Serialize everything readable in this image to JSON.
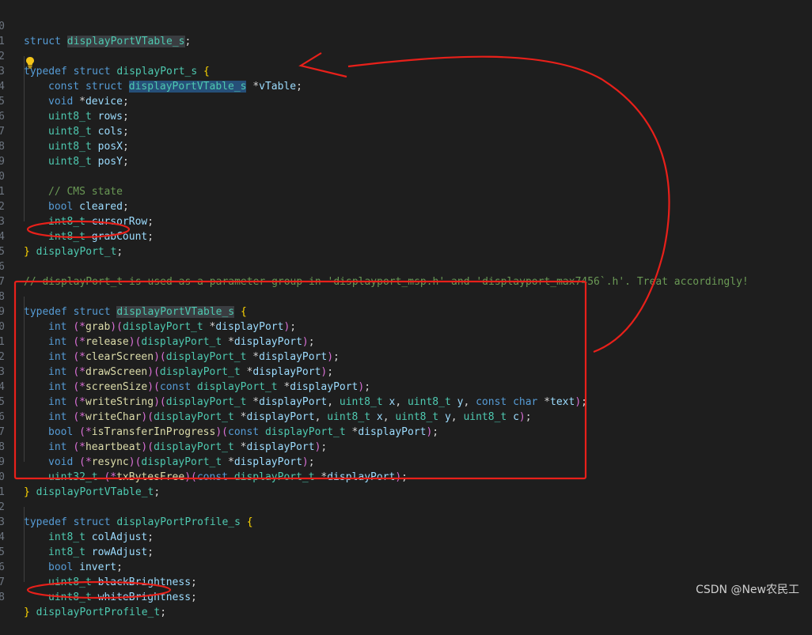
{
  "line_numbers": [
    "0",
    "1",
    "2",
    "3",
    "4",
    "5",
    "6",
    "7",
    "8",
    "9",
    "0",
    "1",
    "2",
    "3",
    "4",
    "5",
    "6",
    "7",
    "8",
    "9",
    "0",
    "1",
    "2",
    "3",
    "4",
    "5",
    "6",
    "7",
    "8",
    "9",
    "0",
    "1",
    "2",
    "3",
    "4",
    "5",
    "6",
    "7",
    "8",
    "9",
    "0"
  ],
  "code": {
    "l0": [
      "struct",
      "displayPortVTable_s",
      ";"
    ],
    "l2": [
      "typedef",
      "struct",
      "displayPort_s",
      "{"
    ],
    "l3": [
      "const",
      "struct",
      "displayPortVTable_s",
      "*",
      "vTable",
      ";"
    ],
    "l4": [
      "void",
      "*",
      "device",
      ";"
    ],
    "l5": [
      "uint8_t",
      "rows",
      ";"
    ],
    "l6": [
      "uint8_t",
      "cols",
      ";"
    ],
    "l7": [
      "uint8_t",
      "posX",
      ";"
    ],
    "l8": [
      "uint8_t",
      "posY",
      ";"
    ],
    "l10": [
      "// CMS state"
    ],
    "l11": [
      "bool",
      "cleared",
      ";"
    ],
    "l12": [
      "int8_t",
      "cursorRow",
      ";"
    ],
    "l13": [
      "int8_t",
      "grabCount",
      ";"
    ],
    "l14": [
      "}",
      "displayPort_t",
      ";"
    ],
    "l16": [
      "// displayPort_t is used as a parameter group in 'displayport_msp.h' and 'displayport_max7456`.h'. Treat accordingly!"
    ],
    "l18": [
      "typedef",
      "struct",
      "displayPortVTable_s",
      "{"
    ],
    "l19": [
      "int",
      "(*",
      "grab",
      ")",
      "(",
      "displayPort_t",
      "*",
      "displayPort",
      ")",
      ";"
    ],
    "l20": [
      "int",
      "(*",
      "release",
      ")",
      "(",
      "displayPort_t",
      "*",
      "displayPort",
      ")",
      ";"
    ],
    "l21": [
      "int",
      "(*",
      "clearScreen",
      ")",
      "(",
      "displayPort_t",
      "*",
      "displayPort",
      ")",
      ";"
    ],
    "l22": [
      "int",
      "(*",
      "drawScreen",
      ")",
      "(",
      "displayPort_t",
      "*",
      "displayPort",
      ")",
      ";"
    ],
    "l23": [
      "int",
      "(*",
      "screenSize",
      ")",
      "(",
      "const",
      "displayPort_t",
      "*",
      "displayPort",
      ")",
      ";"
    ],
    "l24": [
      "int",
      "(*",
      "writeString",
      ")",
      "(",
      "displayPort_t",
      "*",
      "displayPort",
      ",",
      "uint8_t",
      "x",
      ",",
      "uint8_t",
      "y",
      ",",
      "const",
      "char",
      "*",
      "text",
      ")",
      ";"
    ],
    "l25": [
      "int",
      "(*",
      "writeChar",
      ")",
      "(",
      "displayPort_t",
      "*",
      "displayPort",
      ",",
      "uint8_t",
      "x",
      ",",
      "uint8_t",
      "y",
      ",",
      "uint8_t",
      "c",
      ")",
      ";"
    ],
    "l26": [
      "bool",
      "(*",
      "isTransferInProgress",
      ")",
      "(",
      "const",
      "displayPort_t",
      "*",
      "displayPort",
      ")",
      ";"
    ],
    "l27": [
      "int",
      "(*",
      "heartbeat",
      ")",
      "(",
      "displayPort_t",
      "*",
      "displayPort",
      ")",
      ";"
    ],
    "l28": [
      "void",
      "(*",
      "resync",
      ")",
      "(",
      "displayPort_t",
      "*",
      "displayPort",
      ")",
      ";"
    ],
    "l29": [
      "uint32_t",
      "(*",
      "txBytesFree",
      ")",
      "(",
      "const",
      "displayPort_t",
      "*",
      "displayPort",
      ")",
      ";"
    ],
    "l30": [
      "}",
      "displayPortVTable_t",
      ";"
    ],
    "l32": [
      "typedef",
      "struct",
      "displayPortProfile_s",
      "{"
    ],
    "l33": [
      "int8_t",
      "colAdjust",
      ";"
    ],
    "l34": [
      "int8_t",
      "rowAdjust",
      ";"
    ],
    "l35": [
      "bool",
      "invert",
      ";"
    ],
    "l36": [
      "uint8_t",
      "blackBrightness",
      ";"
    ],
    "l37": [
      "uint8_t",
      "whiteBrightness",
      ";"
    ],
    "l38": [
      "}",
      "displayPortProfile_t",
      ";"
    ]
  },
  "colors": {
    "background": "#1e1e1e",
    "keyword": "#569cd6",
    "type": "#4ec9b0",
    "function": "#dcdcaa",
    "variable": "#9cdcfe",
    "comment": "#6a9955",
    "annotation_red": "#e8201a"
  },
  "icons": {
    "lightbulb": "lightbulb-icon"
  },
  "watermark": "CSDN @New农民工"
}
